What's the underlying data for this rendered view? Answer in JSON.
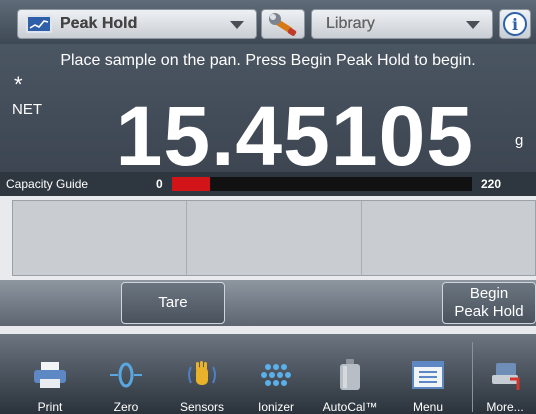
{
  "topbar": {
    "app_selector": "Peak Hold",
    "library_selector": "Library",
    "settings_icon": "wrench-icon",
    "info_icon": "info-icon",
    "info_glyph": "i"
  },
  "display": {
    "instruction": "Place sample on the pan.  Press Begin Peak Hold to begin.",
    "stability_symbol": "*",
    "mode_label": "NET",
    "reading": "15.45105",
    "unit": "g"
  },
  "capacity_guide": {
    "label": "Capacity Guide",
    "min": "0",
    "max": "220",
    "fill_fraction": 0.125,
    "fill_color": "#d21419"
  },
  "actions": {
    "tare_label": "Tare",
    "begin_label_line1": "Begin",
    "begin_label_line2": "Peak Hold"
  },
  "toolbar": {
    "items": [
      {
        "label": "Print",
        "icon": "printer-icon"
      },
      {
        "label": "Zero",
        "icon": "zero-icon"
      },
      {
        "label": "Sensors",
        "icon": "hand-sensor-icon"
      },
      {
        "label": "Ionizer",
        "icon": "ionizer-icon"
      },
      {
        "label": "AutoCal™",
        "icon": "weight-icon"
      },
      {
        "label": "Menu",
        "icon": "menu-window-icon"
      },
      {
        "label": "More...",
        "icon": "more-icon"
      }
    ]
  }
}
